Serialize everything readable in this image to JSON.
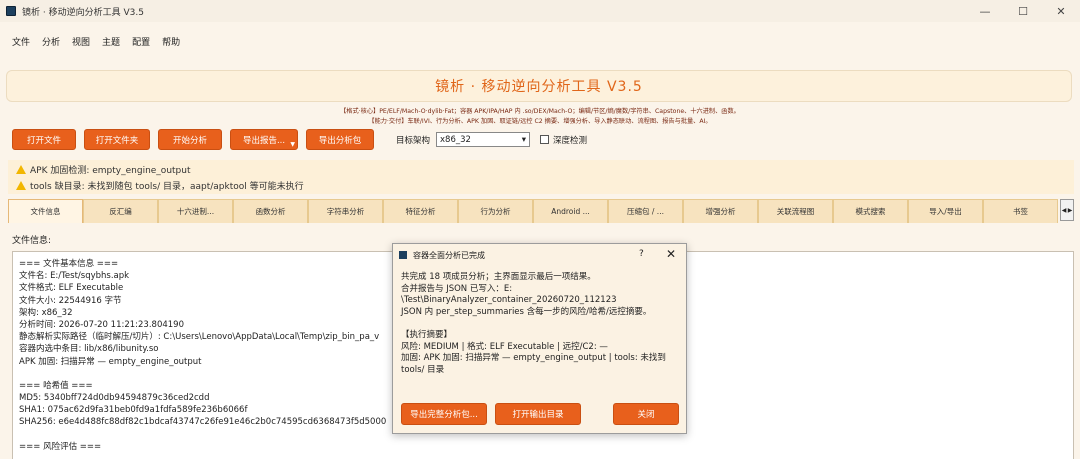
{
  "window": {
    "title": "镜析 · 移动逆向分析工具 V3.5",
    "controls": [
      "—",
      "☐",
      "✕"
    ]
  },
  "menu": [
    "文件",
    "分析",
    "视图",
    "主题",
    "配置",
    "帮助"
  ],
  "banner": {
    "title": "镜析 · 移动逆向分析工具 V3.5",
    "caption_line1": "【格式·核心】PE/ELF/Mach-O·dylib·Fat；容器 APK/IPA/HAP 内 .so/DEX/Mach-O；编辑/节区/熵/魔数/字符串、Capstone、十六进制、函数。",
    "caption_line2": "【能力·交付】车联/IVI、行为分析、APK 加固、取证链/远控 C2 摘要、增强分析、导入静态联动、流程图、报告与批量、AI。"
  },
  "toolbar": {
    "buttons": [
      "打开文件",
      "打开文件夹",
      "开始分析",
      "导出报告...",
      "导出分析包"
    ],
    "arch_label": "目标架构",
    "arch_value": "x86_32",
    "deep_check_label": "深度检测"
  },
  "warnings": [
    "APK 加固检测: empty_engine_output",
    "tools 缺目录: 未找到随包 tools/ 目录，aapt/apktool 等可能未执行"
  ],
  "tabs": [
    "文件信息",
    "反汇编",
    "十六进制...",
    "函数分析",
    "字符串分析",
    "特征分析",
    "行为分析",
    "Android ...",
    "压缩包 / ...",
    "增强分析",
    "关联流程图",
    "模式搜索",
    "导入/导出",
    "书签"
  ],
  "tab_arrows": [
    "◀",
    "▶"
  ],
  "panel_label": "文件信息:",
  "content_lines": [
    "=== 文件基本信息 ===",
    "文件名: E:/Test/sqybhs.apk",
    "文件格式: ELF Executable",
    "文件大小: 22544916 字节",
    "架构: x86_32",
    "分析时间: 2026-07-20 11:21:23.804190",
    "静态解析实际路径（临时解压/切片）: C:\\Users\\Lenovo\\AppData\\Local\\Temp\\zip_bin_pa_v",
    "容器内选中条目: lib/x86/libunity.so",
    "APK 加固: 扫描异常 — empty_engine_output",
    "",
    "=== 哈希值 ===",
    "MD5: 5340bff724d0db94594879c36ced2cdd",
    "SHA1: 075ac62d9fa31beb0fd9a1fdfa589fe236b6066f",
    "SHA256: e6e4d488fc88df82c1bdcaf43747c26fe91e46c2b0c74595cd6368473f5d5000",
    "",
    "=== 风险评估 ==="
  ],
  "dialog": {
    "title": "容器全面分析已完成",
    "help": "?",
    "close": "✕",
    "lines": [
      "共完成 18 项成员分析；主界面显示最后一项结果。",
      "合并报告与 JSON 已写入：E:",
      "\\Test\\BinaryAnalyzer_container_20260720_112123",
      "JSON 内 per_step_summaries 含每一步的风险/哈希/远控摘要。",
      "",
      "【执行摘要】",
      "风险: MEDIUM | 格式: ELF Executable | 远控/C2: —",
      "加固: APK 加固: 扫描异常 — empty_engine_output | tools: 未找到",
      "tools/ 目录"
    ],
    "buttons": [
      "导出完整分析包...",
      "打开输出目录",
      "关闭"
    ]
  }
}
